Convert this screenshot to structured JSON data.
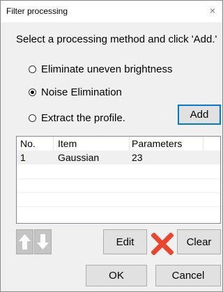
{
  "window": {
    "title": "Filter processing",
    "close_glyph": "×"
  },
  "instruction": "Select a processing method and click 'Add.'",
  "methods": [
    {
      "label": "Eliminate uneven brightness",
      "selected": false
    },
    {
      "label": "Noise Elimination",
      "selected": true
    },
    {
      "label": "Extract the profile.",
      "selected": false
    }
  ],
  "buttons": {
    "add": "Add",
    "edit": "Edit",
    "clear": "Clear",
    "ok": "OK",
    "cancel": "Cancel"
  },
  "table": {
    "headers": [
      "No.",
      "Item",
      "Parameters"
    ],
    "rows": [
      [
        "1",
        "Gaussian",
        "23"
      ]
    ]
  },
  "icons": {
    "move_up": "arrow-up-icon",
    "move_down": "arrow-down-icon",
    "delete": "red-x-delete-icon"
  },
  "colors": {
    "delete_icon": "#e8462e",
    "arrow_icon": "#ffffff",
    "accent": "#0078d7"
  }
}
